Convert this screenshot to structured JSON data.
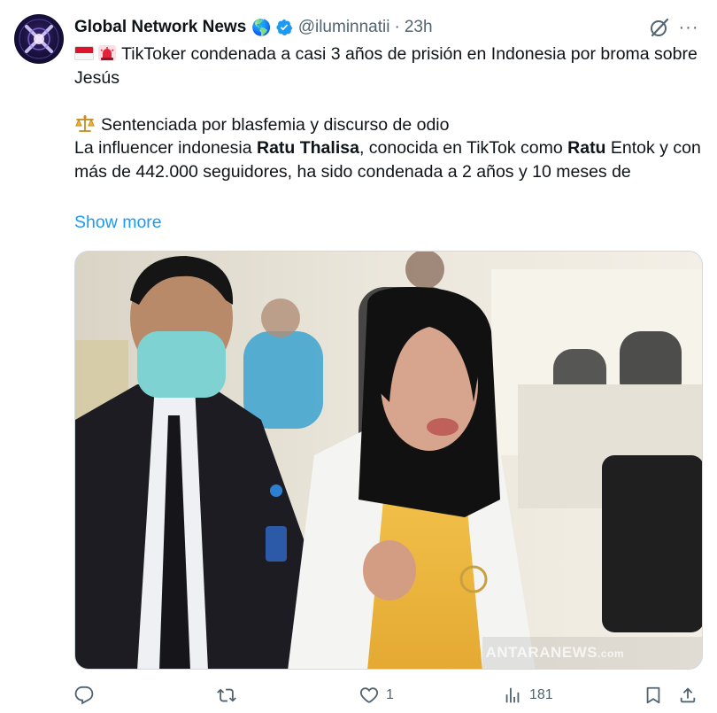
{
  "tweet": {
    "author_name": "Global Network News",
    "author_emoji": "🌎",
    "handle": "@iluminnatii",
    "separator": "·",
    "time": "23h",
    "line1": "TikToker condenada a casi 3 años de prisión en Indonesia por broma sobre Jesús",
    "line2": "Sentenciada por blasfemia y discurso de odio",
    "line3_a": "La influencer indonesia ",
    "line3_b": "Ratu Thalisa",
    "line3_c": ", conocida en TikTok como ",
    "line3_d": "Ratu",
    "line3_e": " Entok y con más de 442.000 seguidores, ha sido condenada a 2 años y 10 meses de",
    "show_more": "Show more"
  },
  "media": {
    "watermark_main": "ANTARANEWS",
    "watermark_sub": ".com"
  },
  "actions": {
    "reply_count": "",
    "repost_count": "",
    "like_count": "1",
    "views_count": "181"
  },
  "icons": {
    "verified": "verified-badge-icon",
    "grok": "grok-icon",
    "more": "more-icon",
    "reply": "reply-icon",
    "repost": "repost-icon",
    "like": "heart-icon",
    "views": "views-icon",
    "bookmark": "bookmark-icon",
    "share": "share-icon"
  },
  "colors": {
    "accent": "#1d9bf0",
    "secondary_text": "#536471",
    "primary_text": "#0f1419"
  }
}
